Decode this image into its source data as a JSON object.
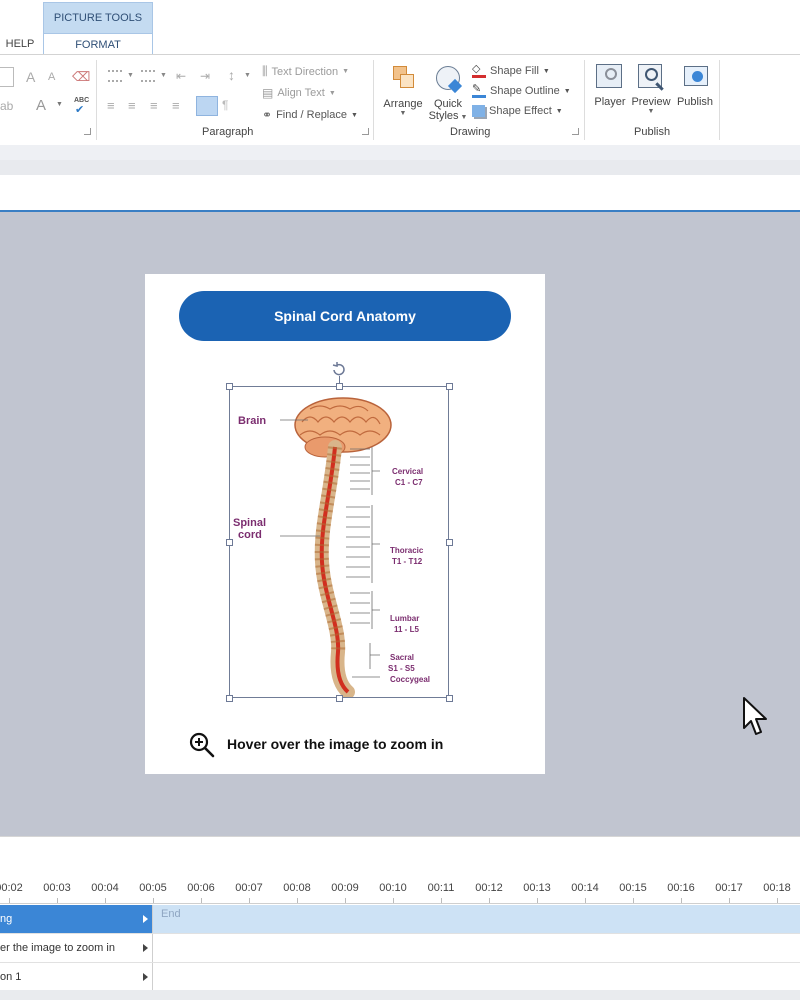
{
  "ribbon": {
    "context_group": "PICTURE TOOLS",
    "tabs": {
      "help": "HELP",
      "format": "FORMAT"
    },
    "paragraph": {
      "text_direction": "Text Direction",
      "align_text": "Align Text",
      "find_replace": "Find / Replace",
      "group_label": "Paragraph"
    },
    "drawing": {
      "arrange": "Arrange",
      "quick": "Quick",
      "styles": "Styles",
      "shape_fill": "Shape Fill",
      "shape_outline": "Shape Outline",
      "shape_effect": "Shape Effect",
      "group_label": "Drawing"
    },
    "publish": {
      "player": "Player",
      "preview": "Preview",
      "publish": "Publish",
      "group_label": "Publish"
    },
    "font_glyphs": {
      "grow": "A",
      "shrink": "A",
      "font_color": "A",
      "spell": "ABC"
    }
  },
  "slide": {
    "title": "Spinal Cord Anatomy",
    "hover_hint": "Hover over the image to zoom in",
    "image_labels": {
      "brain": "Brain",
      "spinal1": "Spinal",
      "spinal2": "cord",
      "cervical1": "Cervical",
      "cervical2": "C1 - C7",
      "thoracic1": "Thoracic",
      "thoracic2": "T1 - T12",
      "lumbar1": "Lumbar",
      "lumbar2": "11 - L5",
      "sacral1": "Sacral",
      "sacral2": "S1 - S5",
      "coccygeal": "Coccygeal"
    }
  },
  "timeline": {
    "ticks": [
      "00:02",
      "00:03",
      "00:04",
      "00:05",
      "00:06",
      "00:07",
      "00:08",
      "00:09",
      "00:10",
      "00:11",
      "00:12",
      "00:13",
      "00:14",
      "00:15",
      "00:16",
      "00:17",
      "00:18"
    ],
    "rows": [
      {
        "name": "ng",
        "selected": true
      },
      {
        "name": "er the image to zoom in",
        "selected": false
      },
      {
        "name": "on 1",
        "selected": false
      }
    ],
    "end_label": "End"
  },
  "colors": {
    "accent": "#1b63b3",
    "selection_row": "#3b86d6",
    "canvas": "#c1c5d0",
    "label_purple": "#7b2d6f"
  }
}
